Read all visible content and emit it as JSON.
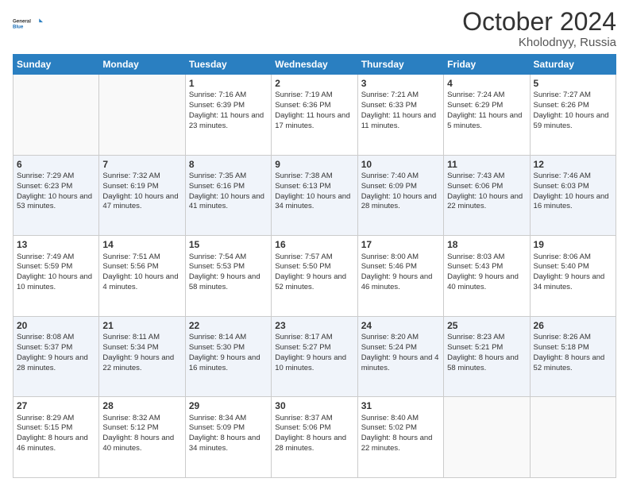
{
  "logo": {
    "line1": "General",
    "line2": "Blue"
  },
  "title": "October 2024",
  "location": "Kholodnyy, Russia",
  "days_header": [
    "Sunday",
    "Monday",
    "Tuesday",
    "Wednesday",
    "Thursday",
    "Friday",
    "Saturday"
  ],
  "weeks": [
    [
      {
        "day": "",
        "info": ""
      },
      {
        "day": "",
        "info": ""
      },
      {
        "day": "1",
        "info": "Sunrise: 7:16 AM\nSunset: 6:39 PM\nDaylight: 11 hours and 23 minutes."
      },
      {
        "day": "2",
        "info": "Sunrise: 7:19 AM\nSunset: 6:36 PM\nDaylight: 11 hours and 17 minutes."
      },
      {
        "day": "3",
        "info": "Sunrise: 7:21 AM\nSunset: 6:33 PM\nDaylight: 11 hours and 11 minutes."
      },
      {
        "day": "4",
        "info": "Sunrise: 7:24 AM\nSunset: 6:29 PM\nDaylight: 11 hours and 5 minutes."
      },
      {
        "day": "5",
        "info": "Sunrise: 7:27 AM\nSunset: 6:26 PM\nDaylight: 10 hours and 59 minutes."
      }
    ],
    [
      {
        "day": "6",
        "info": "Sunrise: 7:29 AM\nSunset: 6:23 PM\nDaylight: 10 hours and 53 minutes."
      },
      {
        "day": "7",
        "info": "Sunrise: 7:32 AM\nSunset: 6:19 PM\nDaylight: 10 hours and 47 minutes."
      },
      {
        "day": "8",
        "info": "Sunrise: 7:35 AM\nSunset: 6:16 PM\nDaylight: 10 hours and 41 minutes."
      },
      {
        "day": "9",
        "info": "Sunrise: 7:38 AM\nSunset: 6:13 PM\nDaylight: 10 hours and 34 minutes."
      },
      {
        "day": "10",
        "info": "Sunrise: 7:40 AM\nSunset: 6:09 PM\nDaylight: 10 hours and 28 minutes."
      },
      {
        "day": "11",
        "info": "Sunrise: 7:43 AM\nSunset: 6:06 PM\nDaylight: 10 hours and 22 minutes."
      },
      {
        "day": "12",
        "info": "Sunrise: 7:46 AM\nSunset: 6:03 PM\nDaylight: 10 hours and 16 minutes."
      }
    ],
    [
      {
        "day": "13",
        "info": "Sunrise: 7:49 AM\nSunset: 5:59 PM\nDaylight: 10 hours and 10 minutes."
      },
      {
        "day": "14",
        "info": "Sunrise: 7:51 AM\nSunset: 5:56 PM\nDaylight: 10 hours and 4 minutes."
      },
      {
        "day": "15",
        "info": "Sunrise: 7:54 AM\nSunset: 5:53 PM\nDaylight: 9 hours and 58 minutes."
      },
      {
        "day": "16",
        "info": "Sunrise: 7:57 AM\nSunset: 5:50 PM\nDaylight: 9 hours and 52 minutes."
      },
      {
        "day": "17",
        "info": "Sunrise: 8:00 AM\nSunset: 5:46 PM\nDaylight: 9 hours and 46 minutes."
      },
      {
        "day": "18",
        "info": "Sunrise: 8:03 AM\nSunset: 5:43 PM\nDaylight: 9 hours and 40 minutes."
      },
      {
        "day": "19",
        "info": "Sunrise: 8:06 AM\nSunset: 5:40 PM\nDaylight: 9 hours and 34 minutes."
      }
    ],
    [
      {
        "day": "20",
        "info": "Sunrise: 8:08 AM\nSunset: 5:37 PM\nDaylight: 9 hours and 28 minutes."
      },
      {
        "day": "21",
        "info": "Sunrise: 8:11 AM\nSunset: 5:34 PM\nDaylight: 9 hours and 22 minutes."
      },
      {
        "day": "22",
        "info": "Sunrise: 8:14 AM\nSunset: 5:30 PM\nDaylight: 9 hours and 16 minutes."
      },
      {
        "day": "23",
        "info": "Sunrise: 8:17 AM\nSunset: 5:27 PM\nDaylight: 9 hours and 10 minutes."
      },
      {
        "day": "24",
        "info": "Sunrise: 8:20 AM\nSunset: 5:24 PM\nDaylight: 9 hours and 4 minutes."
      },
      {
        "day": "25",
        "info": "Sunrise: 8:23 AM\nSunset: 5:21 PM\nDaylight: 8 hours and 58 minutes."
      },
      {
        "day": "26",
        "info": "Sunrise: 8:26 AM\nSunset: 5:18 PM\nDaylight: 8 hours and 52 minutes."
      }
    ],
    [
      {
        "day": "27",
        "info": "Sunrise: 8:29 AM\nSunset: 5:15 PM\nDaylight: 8 hours and 46 minutes."
      },
      {
        "day": "28",
        "info": "Sunrise: 8:32 AM\nSunset: 5:12 PM\nDaylight: 8 hours and 40 minutes."
      },
      {
        "day": "29",
        "info": "Sunrise: 8:34 AM\nSunset: 5:09 PM\nDaylight: 8 hours and 34 minutes."
      },
      {
        "day": "30",
        "info": "Sunrise: 8:37 AM\nSunset: 5:06 PM\nDaylight: 8 hours and 28 minutes."
      },
      {
        "day": "31",
        "info": "Sunrise: 8:40 AM\nSunset: 5:02 PM\nDaylight: 8 hours and 22 minutes."
      },
      {
        "day": "",
        "info": ""
      },
      {
        "day": "",
        "info": ""
      }
    ]
  ]
}
